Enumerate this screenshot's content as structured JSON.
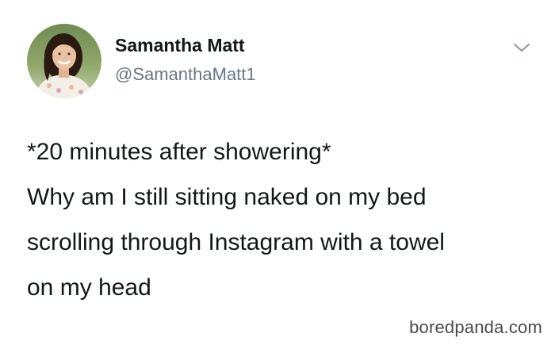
{
  "tweet": {
    "author": {
      "display_name": "Samantha Matt",
      "handle": "@SamanthaMatt1"
    },
    "menu_icon": "chevron-down-icon",
    "text_lines": [
      "*20 minutes after showering*",
      "Why am I still sitting naked on my bed",
      "scrolling through Instagram with a towel",
      "on my head"
    ]
  },
  "watermark": "boredpanda.com",
  "colors": {
    "text_primary": "#14171a",
    "text_secondary": "#657786",
    "caret": "#8899a6",
    "watermark": "#4a4a4a",
    "background": "#ffffff"
  }
}
